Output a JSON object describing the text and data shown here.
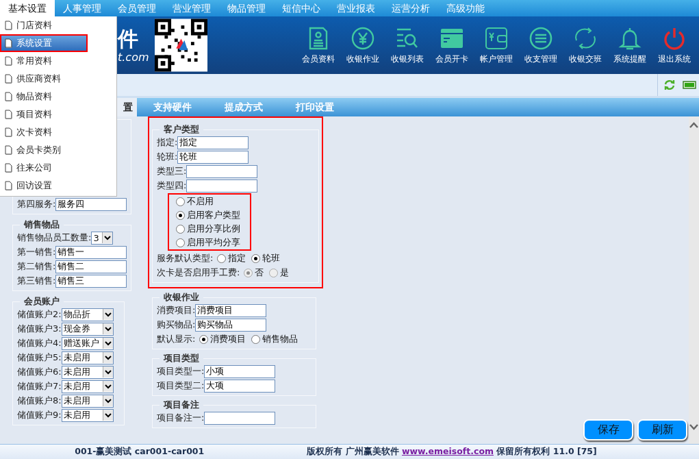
{
  "menu_bar": {
    "items": [
      {
        "label": "基本设置",
        "selected": true
      },
      {
        "label": "人事管理",
        "selected": false
      },
      {
        "label": "会员管理",
        "selected": false
      },
      {
        "label": "营业管理",
        "selected": false
      },
      {
        "label": "物品管理",
        "selected": false
      },
      {
        "label": "短信中心",
        "selected": false
      },
      {
        "label": "营业报表",
        "selected": false
      },
      {
        "label": "运营分析",
        "selected": false
      },
      {
        "label": "高级功能",
        "selected": false
      }
    ]
  },
  "dropdown": {
    "items": [
      {
        "label": "门店资料",
        "selected": false,
        "annotated": false
      },
      {
        "label": "系统设置",
        "selected": true,
        "annotated": true
      },
      {
        "label": "常用资料",
        "selected": false,
        "annotated": false
      },
      {
        "label": "供应商资料",
        "selected": false,
        "annotated": false
      },
      {
        "label": "物品资料",
        "selected": false,
        "annotated": false
      },
      {
        "label": "项目资料",
        "selected": false,
        "annotated": false
      },
      {
        "label": "次卡资料",
        "selected": false,
        "annotated": false
      },
      {
        "label": "会员卡类别",
        "selected": false,
        "annotated": false
      },
      {
        "label": "往来公司",
        "selected": false,
        "annotated": false
      },
      {
        "label": "回访设置",
        "selected": false,
        "annotated": false
      }
    ]
  },
  "header": {
    "logo_text": "件",
    "logo_url": "t.com",
    "toolbar": [
      {
        "label": "会员资料"
      },
      {
        "label": "收银作业"
      },
      {
        "label": "收银列表"
      },
      {
        "label": "会员开卡"
      },
      {
        "label": "帐户管理"
      },
      {
        "label": "收支管理"
      },
      {
        "label": "收银交班"
      },
      {
        "label": "系统提醒"
      },
      {
        "label": "退出系统"
      }
    ]
  },
  "tabs": [
    {
      "label": "置",
      "selected": true
    },
    {
      "label": "支持硬件",
      "selected": false
    },
    {
      "label": "提成方式",
      "selected": false
    },
    {
      "label": "打印设置",
      "selected": false
    }
  ],
  "service": {
    "rows": [
      {
        "label": "第四服务:",
        "value": "服务四"
      }
    ]
  },
  "sales": {
    "title": "销售物品",
    "count_label": "销售物品员工数量:",
    "count_value": "3",
    "rows": [
      {
        "label": "第一销售:",
        "value": "销售一"
      },
      {
        "label": "第二销售:",
        "value": "销售二"
      },
      {
        "label": "第三销售:",
        "value": "销售三"
      }
    ]
  },
  "accounts": {
    "title": "会员账户",
    "rows": [
      {
        "label": "储值账户2:",
        "value": "物品折"
      },
      {
        "label": "储值账户3:",
        "value": "现金券"
      },
      {
        "label": "储值账户4:",
        "value": "赠送账户"
      },
      {
        "label": "储值账户5:",
        "value": "未启用"
      },
      {
        "label": "储值账户6:",
        "value": "未启用"
      },
      {
        "label": "储值账户7:",
        "value": "未启用"
      },
      {
        "label": "储值账户8:",
        "value": "未启用"
      },
      {
        "label": "储值账户9:",
        "value": "未启用"
      }
    ]
  },
  "customer_type": {
    "title": "客户类型",
    "annotated": true,
    "rows": [
      {
        "label": "指定:",
        "value": "指定"
      },
      {
        "label": "轮班:",
        "value": "轮班"
      },
      {
        "label": "类型三:"
      },
      {
        "label": "类型四:"
      }
    ],
    "mode": {
      "annotated": true,
      "options": [
        {
          "label": "不启用",
          "selected": false
        },
        {
          "label": "启用客户类型",
          "selected": true
        },
        {
          "label": "启用分享比例",
          "selected": false
        },
        {
          "label": "启用平均分享",
          "selected": false
        }
      ]
    },
    "choices": [
      {
        "label": "服务默认类型:",
        "disabled": false,
        "options": [
          {
            "label": "指定",
            "selected": false
          },
          {
            "label": "轮班",
            "selected": true
          }
        ]
      },
      {
        "label": "次卡是否启用手工费:",
        "disabled": true,
        "options": [
          {
            "label": "否",
            "selected": true
          },
          {
            "label": "是",
            "selected": false
          }
        ]
      }
    ]
  },
  "cashier": {
    "title": "收银作业",
    "rows": [
      {
        "label": "消费项目:",
        "value": "消费项目"
      },
      {
        "label": "购买物品:",
        "value": "购买物品"
      }
    ],
    "display": {
      "label": "默认显示:",
      "disabled": false,
      "options": [
        {
          "label": "消费项目",
          "selected": true
        },
        {
          "label": "销售物品",
          "selected": false
        }
      ]
    }
  },
  "item_types": {
    "title": "项目类型",
    "rows": [
      {
        "label": "项目类型一:",
        "value": "小项"
      },
      {
        "label": "项目类型二:",
        "value": "大项"
      }
    ]
  },
  "item_notes": {
    "title": "项目备注",
    "rows": [
      {
        "label": "项目备注一:"
      }
    ]
  },
  "buttons": [
    {
      "label": "保存"
    },
    {
      "label": "刷新"
    }
  ],
  "footer": {
    "account": "001-赢美测试 car001-car001",
    "copyright": "版权所有 广州赢美软件",
    "link": "www.emeisoft.com",
    "suffix": "保留所有权利 11.0 [75]"
  }
}
